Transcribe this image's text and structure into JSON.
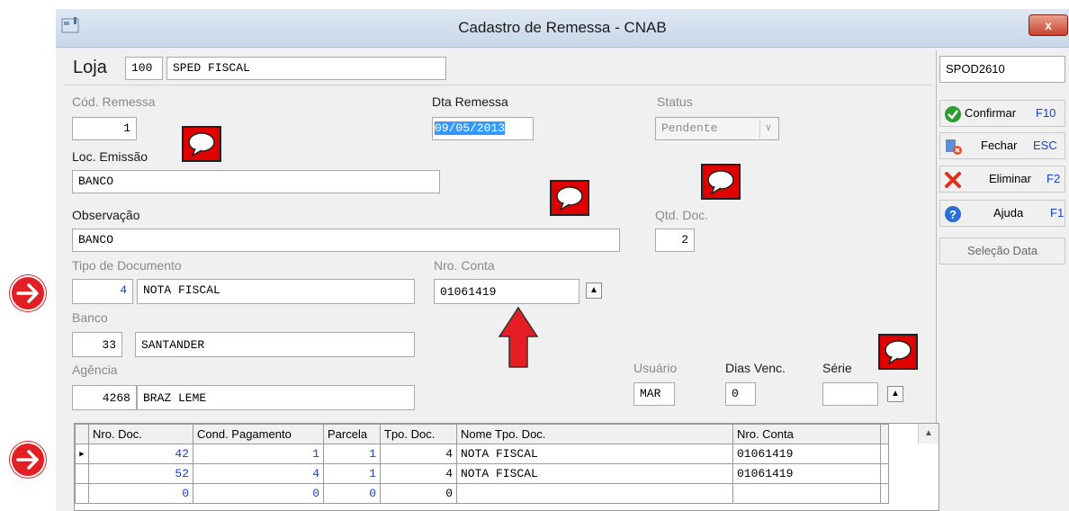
{
  "window": {
    "title": "Cadastro de Remessa - CNAB",
    "close_label": "x"
  },
  "loja": {
    "label": "Loja",
    "code": "100",
    "name": "SPED FISCAL"
  },
  "top_right_code": "SPOD2610",
  "form": {
    "cod_remessa": {
      "label": "Cód. Remessa",
      "value": "1"
    },
    "dta_remessa": {
      "label": "Dta Remessa",
      "value": "09/05/2013"
    },
    "status": {
      "label": "Status",
      "value": "Pendente"
    },
    "loc_emissao": {
      "label": "Loc. Emissão",
      "value": "BANCO"
    },
    "observacao": {
      "label": "Observação",
      "value": "BANCO"
    },
    "qtd_doc": {
      "label": "Qtd. Doc.",
      "value": "2"
    },
    "tipo_documento": {
      "label": "Tipo de Documento",
      "code": "4",
      "name": "NOTA FISCAL"
    },
    "nro_conta": {
      "label": "Nro. Conta",
      "value": "01061419"
    },
    "banco": {
      "label": "Banco",
      "code": "33",
      "name": "SANTANDER"
    },
    "agencia": {
      "label": "Agência",
      "code": "4268",
      "name": "BRAZ LEME"
    },
    "usuario": {
      "label": "Usuário",
      "value": "MAR"
    },
    "dias_venc": {
      "label": "Dias Venc.",
      "value": "0"
    },
    "serie": {
      "label": "Série",
      "value": ""
    }
  },
  "sidebar": {
    "confirmar": {
      "label": "Confirmar",
      "key": "F10"
    },
    "fechar": {
      "label": "Fechar",
      "key": "ESC"
    },
    "eliminar": {
      "label": "Eliminar",
      "key": "F2"
    },
    "ajuda": {
      "label": "Ajuda",
      "key": "F1"
    },
    "selecao": {
      "label": "Seleção Data"
    }
  },
  "grid": {
    "headers": [
      "Nro. Doc.",
      "Cond. Pagamento",
      "Parcela",
      "Tpo. Doc.",
      "Nome Tpo. Doc.",
      "Nro. Conta"
    ],
    "rows": [
      [
        "42",
        "1",
        "1",
        "4",
        "NOTA FISCAL",
        "01061419"
      ],
      [
        "52",
        "4",
        "1",
        "4",
        "NOTA FISCAL",
        "01061419"
      ],
      [
        "0",
        "0",
        "0",
        "0",
        "",
        ""
      ]
    ]
  },
  "colors": {
    "accent_red": "#e00000",
    "selection_blue": "#3399ff",
    "grid_blue": "#1a3fcc"
  },
  "icons": [
    "window-app-icon",
    "close-icon",
    "speech-bubble-icon",
    "red-arrow-circle-icon",
    "up-arrow-icon",
    "check-icon",
    "close-door-icon",
    "delete-x-icon",
    "help-icon",
    "lookup-arrow-icon",
    "row-pointer-icon",
    "scroll-up-icon"
  ]
}
